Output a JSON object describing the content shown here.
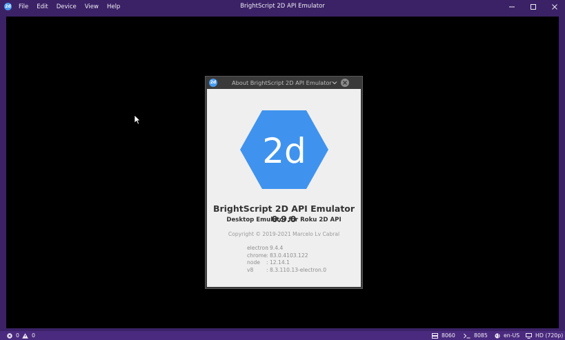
{
  "window": {
    "title": "BrightScript 2D API Emulator",
    "app_icon": "2d",
    "menus": [
      "File",
      "Edit",
      "Device",
      "View",
      "Help"
    ]
  },
  "dialog": {
    "title": "About BrightScript 2D API Emulator",
    "logo_text": "2d",
    "heading": "BrightScript 2D API Emulator 0.9.0",
    "subheading": "Desktop Emulator for Roku 2D API",
    "copyright": "Copyright © 2019-2021 Marcelo Lv Cabral",
    "versions": [
      {
        "key": "electron",
        "value": ": 9.4.4"
      },
      {
        "key": "chrome",
        "value": ": 83.0.4103.122"
      },
      {
        "key": "node",
        "value": ": 12.14.1"
      },
      {
        "key": "v8",
        "value": ": 8.3.110.13-electron.0"
      }
    ]
  },
  "statusbar": {
    "errors": "0",
    "warnings": "0",
    "port_ecp": "8060",
    "port_console": "8085",
    "locale": "en-US",
    "resolution": "HD (720p)"
  },
  "colors": {
    "chrome": "#3b2266",
    "statusbar": "#4a2a7e",
    "logo": "#3f93ee"
  }
}
